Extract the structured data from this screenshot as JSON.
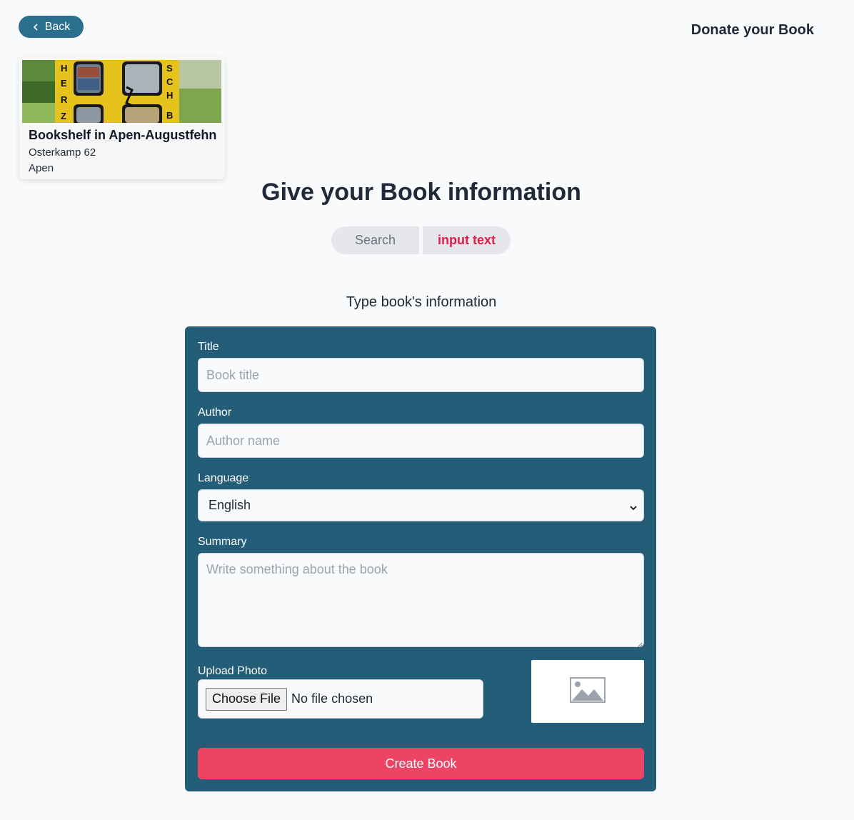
{
  "nav": {
    "back_label": "Back",
    "header_title": "Donate your Book"
  },
  "bookshelf": {
    "name": "Bookshelf in Apen-Augustfehn",
    "street": "Osterkamp 62",
    "city": "Apen",
    "image_letters_left": [
      "H",
      "E",
      "R",
      "Z"
    ],
    "image_letters_right": [
      "S",
      "C",
      "H",
      "B"
    ]
  },
  "main": {
    "heading": "Give your Book information",
    "tabs": [
      {
        "label": "Search",
        "active": false
      },
      {
        "label": "input text",
        "active": true
      }
    ],
    "subtitle": "Type book's information"
  },
  "form": {
    "title_label": "Title",
    "title_placeholder": "Book title",
    "title_value": "",
    "author_label": "Author",
    "author_placeholder": "Author name",
    "author_value": "",
    "language_label": "Language",
    "language_value": "English",
    "summary_label": "Summary",
    "summary_placeholder": "Write something about the book",
    "summary_value": "",
    "upload_label": "Upload Photo",
    "choose_file_label": "Choose File",
    "no_file_text": "No file chosen",
    "submit_label": "Create Book"
  },
  "colors": {
    "primary": "#245d78",
    "back_button": "#2b6f8e",
    "accent": "#ed4463",
    "active_tab_text": "#e11d48",
    "background": "#f8fafc"
  },
  "icons": {
    "back": "chevron-left-icon",
    "select": "chevron-down-icon",
    "preview": "image-placeholder-icon"
  }
}
